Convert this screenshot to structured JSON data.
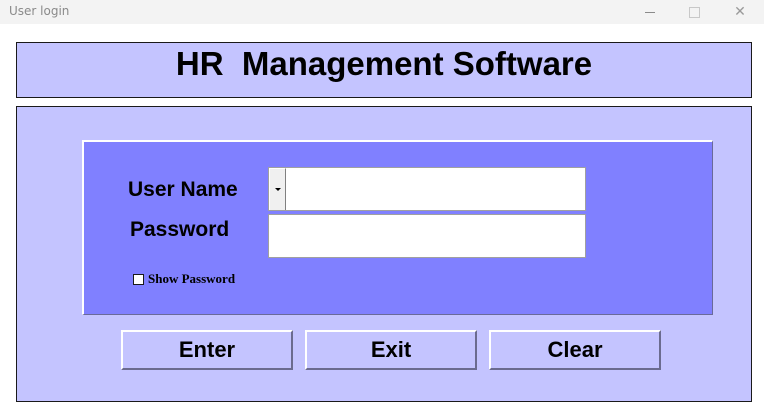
{
  "window": {
    "title": "User login",
    "minimize_icon": "minimize-icon",
    "maximize_icon": "maximize-icon",
    "close_icon": "close-icon",
    "close_glyph": "✕"
  },
  "header": {
    "title": "HR  Management Software"
  },
  "login": {
    "username_label": "User Name",
    "username_value": "",
    "password_label": "Password",
    "password_value": "",
    "show_password_label": "Show Password",
    "show_password_checked": false
  },
  "buttons": {
    "enter": "Enter",
    "exit": "Exit",
    "clear": "Clear"
  },
  "colors": {
    "panel": "#c4c4ff",
    "inner_panel": "#8080ff"
  }
}
